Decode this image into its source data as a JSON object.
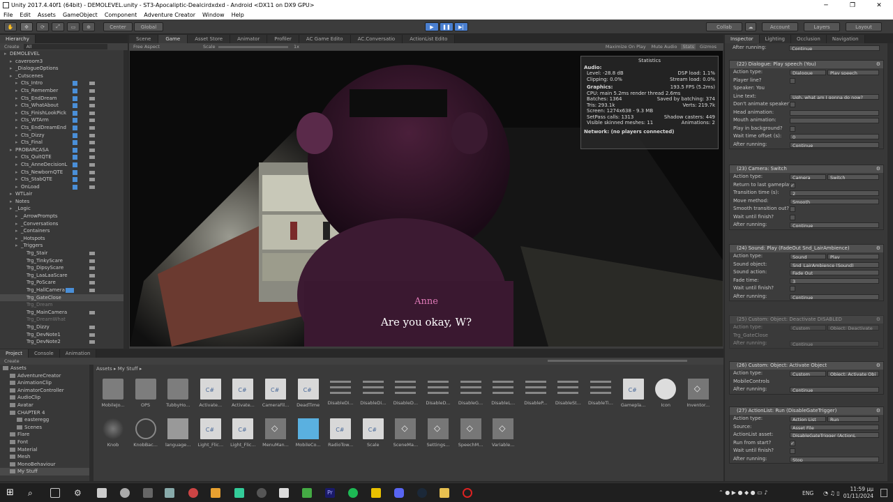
{
  "window": {
    "title": "Unity 2017.4.40f1 (64bit) - DEMOLEVEL.unity - ST3-Apocaliptic-Dealcirdxdxd - Android <DX11 on DX9 GPU>"
  },
  "menu": [
    "File",
    "Edit",
    "Assets",
    "GameObject",
    "Component",
    "Adventure Creator",
    "Window",
    "Help"
  ],
  "toolbar": {
    "center": "Center",
    "global": "Global",
    "collab": "Collab",
    "account": "Account",
    "layers": "Layers",
    "layout": "Layout"
  },
  "hierarchy": {
    "tab": "Hierarchy",
    "create": "Create",
    "search": "All",
    "rows": [
      {
        "label": "DEMOLEVEL",
        "indent": 0,
        "bars": 0
      },
      {
        "label": "caveroom3",
        "indent": 1,
        "bars": 0
      },
      {
        "label": "_DialogueOptions",
        "indent": 1,
        "bars": 0
      },
      {
        "label": "_Cutscenes",
        "indent": 1,
        "bars": 0
      },
      {
        "label": "Cts_Intro",
        "indent": 2,
        "bars": 2
      },
      {
        "label": "Cts_Remember",
        "indent": 2,
        "bars": 2
      },
      {
        "label": "Cts_EndDream",
        "indent": 2,
        "bars": 2
      },
      {
        "label": "Cts_WhatAbout",
        "indent": 2,
        "bars": 2
      },
      {
        "label": "Cts_FinishLookPick",
        "indent": 2,
        "bars": 2
      },
      {
        "label": "Cts_WTArm",
        "indent": 2,
        "bars": 2
      },
      {
        "label": "Cts_EndDreamEnd",
        "indent": 2,
        "bars": 2
      },
      {
        "label": "Cts_Dizzy",
        "indent": 2,
        "bars": 2
      },
      {
        "label": "Cts_Final",
        "indent": 2,
        "bars": 2
      },
      {
        "label": "PROBARCASA",
        "indent": 1,
        "bars": 2
      },
      {
        "label": "Cts_QuitQTE",
        "indent": 2,
        "bars": 2
      },
      {
        "label": "Cts_AnneDecisionL",
        "indent": 2,
        "bars": 2
      },
      {
        "label": "Cts_NewbornQTE",
        "indent": 2,
        "bars": 2
      },
      {
        "label": "Cts_StabQTE",
        "indent": 2,
        "bars": 2
      },
      {
        "label": "OnLoad",
        "indent": 2,
        "bars": 2
      },
      {
        "label": "WTLair",
        "indent": 1,
        "bars": 0
      },
      {
        "label": "Notes",
        "indent": 1,
        "bars": 0
      },
      {
        "label": "_Logic",
        "indent": 1,
        "bars": 0
      },
      {
        "label": "_ArrowPrompts",
        "indent": 2,
        "bars": 0
      },
      {
        "label": "_Conversations",
        "indent": 2,
        "bars": 0
      },
      {
        "label": "_Containers",
        "indent": 2,
        "bars": 0
      },
      {
        "label": "_Hotspots",
        "indent": 2,
        "bars": 0
      },
      {
        "label": "_Triggers",
        "indent": 2,
        "bars": 0
      },
      {
        "label": "Trg_Stair",
        "indent": 3,
        "bars": 1
      },
      {
        "label": "Trg_TinkyScare",
        "indent": 3,
        "bars": 1
      },
      {
        "label": "Trg_DipsyScare",
        "indent": 3,
        "bars": 1
      },
      {
        "label": "Trg_LaaLaaScare",
        "indent": 3,
        "bars": 1
      },
      {
        "label": "Trg_PoScare",
        "indent": 3,
        "bars": 1
      },
      {
        "label": "Trg_HallCamera",
        "indent": 3,
        "bars": 1
      },
      {
        "label": "Trg_GateClose",
        "indent": 3,
        "bars": 0
      },
      {
        "label": "Trg_Dream",
        "indent": 3,
        "bars": 0
      },
      {
        "label": "Trg_MainCamera",
        "indent": 3,
        "bars": 1
      },
      {
        "label": "Trg_DreamWhat",
        "indent": 3,
        "bars": 0
      },
      {
        "label": "Trg_Dizzy",
        "indent": 3,
        "bars": 1
      },
      {
        "label": "Trg_DevNote1",
        "indent": 3,
        "bars": 1
      },
      {
        "label": "Trg_DevNote2",
        "indent": 3,
        "bars": 1
      }
    ]
  },
  "sceneTabs": [
    "Scene",
    "Game",
    "Asset Store",
    "Animator",
    "Profiler",
    "AC Game Edito",
    "AC.Conversatio",
    "ActionList Edito"
  ],
  "gameBar": {
    "aspect": "Free Aspect",
    "scale_label": "Scale",
    "scale_value": "1x",
    "buttons": [
      "Maximize On Play",
      "Mute Audio",
      "Stats",
      "Gizmos"
    ]
  },
  "subtitle": {
    "speaker": "Anne",
    "line": "Are you okay, W?"
  },
  "stats": {
    "title": "Statistics",
    "audio_h": "Audio:",
    "level": "Level: -28.8 dB",
    "dsp": "DSP load: 1.1%",
    "clipping": "Clipping: 0.0%",
    "stream": "Stream load: 0.0%",
    "graphics_h": "Graphics:",
    "fps": "193.5 FPS (5.2ms)",
    "cpu": "CPU: main 5.2ms  render thread 2.6ms",
    "batches": "Batches: 1364",
    "saved": "Saved by batching: 374",
    "tris": "Tris: 293.1k",
    "verts": "Verts: 219.7k",
    "screen": "Screen: 1274x638 - 9.3 MB",
    "setpass": "SetPass calls: 1313",
    "shadow": "Shadow casters: 449",
    "skinned": "Visible skinned meshes: 11",
    "anims": "Animations: 2",
    "network": "Network: (no players connected)"
  },
  "inspector": {
    "tabs": [
      "Inspector",
      "Lighting",
      "Occlusion",
      "Navigation"
    ],
    "top_after": {
      "label": "After running:",
      "value": "Continue"
    },
    "sections": [
      {
        "header": "(22) Dialogue: Play speech (You)",
        "rows": [
          {
            "label": "Action type:",
            "value": "Dialogue",
            "value2": "Play speech"
          },
          {
            "label": "Player line?",
            "check": ""
          },
          {
            "label": "Speaker: You"
          },
          {
            "label": "Line text:",
            "value": "Ugh, what am I gonna do now?"
          },
          {
            "label": "Don't animate speaker?",
            "check": ""
          },
          {
            "label": "Head animation:",
            "value": ""
          },
          {
            "label": "Mouth animation:",
            "value": ""
          },
          {
            "label": "Play in background?",
            "check": ""
          },
          {
            "label": "Wait time offset (s):",
            "value": "0"
          },
          {
            "label": "After running:",
            "value": "Continue"
          }
        ]
      },
      {
        "header": "(23) Camera: Switch",
        "rows": [
          {
            "label": "Action type:",
            "value": "Camera",
            "value2": "Switch"
          },
          {
            "label": "Return to last gameplay?",
            "check": "✓"
          },
          {
            "label": "Transition time (s):",
            "value": "2"
          },
          {
            "label": "Move method:",
            "value": "Smooth"
          },
          {
            "label": "Smooth transition out?",
            "check": ""
          },
          {
            "label": "Wait until finish?",
            "check": ""
          },
          {
            "label": "After running:",
            "value": "Continue"
          }
        ]
      },
      {
        "header": "(24) Sound: Play (FadeOut Snd_LairAmbience)",
        "rows": [
          {
            "label": "Action type:",
            "value": "Sound",
            "value2": "Play"
          },
          {
            "label": "Sound object:",
            "value": "Snd_LairAmbience (Sound)"
          },
          {
            "label": "Sound action:",
            "value": "Fade Out"
          },
          {
            "label": "Fade time:",
            "value": "3"
          },
          {
            "label": "Wait until finish?",
            "check": ""
          },
          {
            "label": "After running:",
            "value": "Continue"
          }
        ]
      },
      {
        "header": "(25) Custom: Object: Deactivate  DISABLED",
        "disabled": true,
        "rows": [
          {
            "label": "Action type:",
            "value": "Custom",
            "value2": "Object: Deactivate"
          },
          {
            "label": "Trg_GateClose"
          },
          {
            "label": "After running:",
            "value": "Continue"
          }
        ]
      },
      {
        "header": "(26) Custom: Object: Activate Object",
        "rows": [
          {
            "label": "Action type:",
            "value": "Custom",
            "value2": "Object: Activate Obj"
          },
          {
            "label": "MobileControls"
          },
          {
            "label": "After running:",
            "value": "Continue"
          }
        ]
      },
      {
        "header": "(27) ActionList: Run (DisableGateTrigger)",
        "rows": [
          {
            "label": "Action type:",
            "value": "Action List",
            "value2": "Run"
          },
          {
            "label": "Source:",
            "value": "Asset File"
          },
          {
            "label": "ActionList asset:",
            "value": "DisableGateTrigger (ActionL"
          },
          {
            "label": "Run from start?",
            "check": "✓"
          },
          {
            "label": "Wait until finish?",
            "check": ""
          },
          {
            "label": "After running:",
            "value": "Stop"
          }
        ]
      }
    ]
  },
  "project": {
    "tabs": [
      "Project",
      "Console",
      "Animation"
    ],
    "create": "Create",
    "breadcrumb": [
      "Assets",
      "My Stuff"
    ],
    "tree": [
      "Assets",
      "AdventureCreator",
      "AnimationClip",
      "AnimatorController",
      "AudioClip",
      "Avatar",
      "CHAPTER 4",
      "easteregg",
      "Scenes",
      "Flare",
      "Font",
      "Material",
      "Mesh",
      "MonoBehaviour",
      "My Stuff"
    ],
    "assets_row1": [
      {
        "name": "MobileJo...",
        "kind": "folder"
      },
      {
        "name": "OPS",
        "kind": "folder"
      },
      {
        "name": "TubbyHo...",
        "kind": "folder"
      },
      {
        "name": "Activate...",
        "kind": "script"
      },
      {
        "name": "Activate...",
        "kind": "script"
      },
      {
        "name": "CameraFil...",
        "kind": "script"
      },
      {
        "name": "DeadTime",
        "kind": "script"
      },
      {
        "name": "DisableDi...",
        "kind": "list"
      },
      {
        "name": "DisableDi...",
        "kind": "list"
      },
      {
        "name": "DisableD...",
        "kind": "list"
      },
      {
        "name": "DisableD...",
        "kind": "list"
      },
      {
        "name": "DisableG...",
        "kind": "list"
      },
      {
        "name": "DisableL...",
        "kind": "list"
      },
      {
        "name": "DisableP...",
        "kind": "list"
      },
      {
        "name": "DisableSt...",
        "kind": "list"
      },
      {
        "name": "DisableTi...",
        "kind": "list"
      },
      {
        "name": "Gamepla...",
        "kind": "script"
      },
      {
        "name": "Icon",
        "kind": "image"
      },
      {
        "name": "Inventor...",
        "kind": "unity"
      }
    ],
    "assets_row2": [
      {
        "name": "Knob",
        "kind": "knob"
      },
      {
        "name": "KnobBac...",
        "kind": "ring"
      },
      {
        "name": "language...",
        "kind": "file"
      },
      {
        "name": "Light_Flic...",
        "kind": "script"
      },
      {
        "name": "Light_Flic...",
        "kind": "script"
      },
      {
        "name": "MenuMan...",
        "kind": "unity"
      },
      {
        "name": "MobileCo...",
        "kind": "cube"
      },
      {
        "name": "RadioTow...",
        "kind": "script"
      },
      {
        "name": "Scale",
        "kind": "script"
      },
      {
        "name": "SceneMa...",
        "kind": "unity"
      },
      {
        "name": "Settings...",
        "kind": "unity"
      },
      {
        "name": "SpeechM...",
        "kind": "unity"
      },
      {
        "name": "Variable...",
        "kind": "unity"
      }
    ]
  },
  "taskbar": {
    "lang": "ENG",
    "time": "11:59 μμ",
    "date": "01/11/2024"
  }
}
